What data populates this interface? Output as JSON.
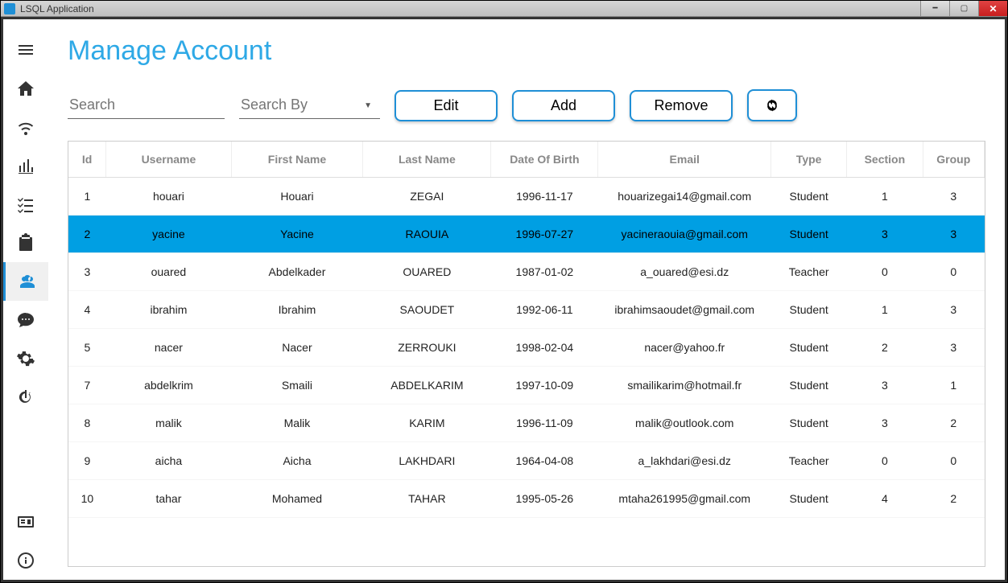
{
  "window": {
    "title": "LSQL Application"
  },
  "page": {
    "title": "Manage Account"
  },
  "search": {
    "placeholder": "Search",
    "searchByPlaceholder": "Search By"
  },
  "buttons": {
    "edit": "Edit",
    "add": "Add",
    "remove": "Remove"
  },
  "table": {
    "headers": [
      "Id",
      "Username",
      "First Name",
      "Last Name",
      "Date Of Birth",
      "Email",
      "Type",
      "Section",
      "Group"
    ],
    "selectedIndex": 1,
    "rows": [
      {
        "id": "1",
        "username": "houari",
        "firstName": "Houari",
        "lastName": "ZEGAI",
        "dob": "1996-11-17",
        "email": "houarizegai14@gmail.com",
        "type": "Student",
        "section": "1",
        "group": "3"
      },
      {
        "id": "2",
        "username": "yacine",
        "firstName": "Yacine",
        "lastName": "RAOUIA",
        "dob": "1996-07-27",
        "email": "yacineraouia@gmail.com",
        "type": "Student",
        "section": "3",
        "group": "3"
      },
      {
        "id": "3",
        "username": "ouared",
        "firstName": "Abdelkader",
        "lastName": "OUARED",
        "dob": "1987-01-02",
        "email": "a_ouared@esi.dz",
        "type": "Teacher",
        "section": "0",
        "group": "0"
      },
      {
        "id": "4",
        "username": "ibrahim",
        "firstName": "Ibrahim",
        "lastName": "SAOUDET",
        "dob": "1992-06-11",
        "email": "ibrahimsaoudet@gmail.com",
        "type": "Student",
        "section": "1",
        "group": "3"
      },
      {
        "id": "5",
        "username": "nacer",
        "firstName": "Nacer",
        "lastName": "ZERROUKI",
        "dob": "1998-02-04",
        "email": "nacer@yahoo.fr",
        "type": "Student",
        "section": "2",
        "group": "3"
      },
      {
        "id": "7",
        "username": "abdelkrim",
        "firstName": "Smaili",
        "lastName": "ABDELKARIM",
        "dob": "1997-10-09",
        "email": "smailikarim@hotmail.fr",
        "type": "Student",
        "section": "3",
        "group": "1"
      },
      {
        "id": "8",
        "username": "malik",
        "firstName": "Malik",
        "lastName": "KARIM",
        "dob": "1996-11-09",
        "email": "malik@outlook.com",
        "type": "Student",
        "section": "3",
        "group": "2"
      },
      {
        "id": "9",
        "username": "aicha",
        "firstName": "Aicha",
        "lastName": "LAKHDARI",
        "dob": "1964-04-08",
        "email": "a_lakhdari@esi.dz",
        "type": "Teacher",
        "section": "0",
        "group": "0"
      },
      {
        "id": "10",
        "username": "tahar",
        "firstName": "Mohamed",
        "lastName": "TAHAR",
        "dob": "1995-05-26",
        "email": "mtaha261995@gmail.com",
        "type": "Student",
        "section": "4",
        "group": "2"
      }
    ]
  }
}
